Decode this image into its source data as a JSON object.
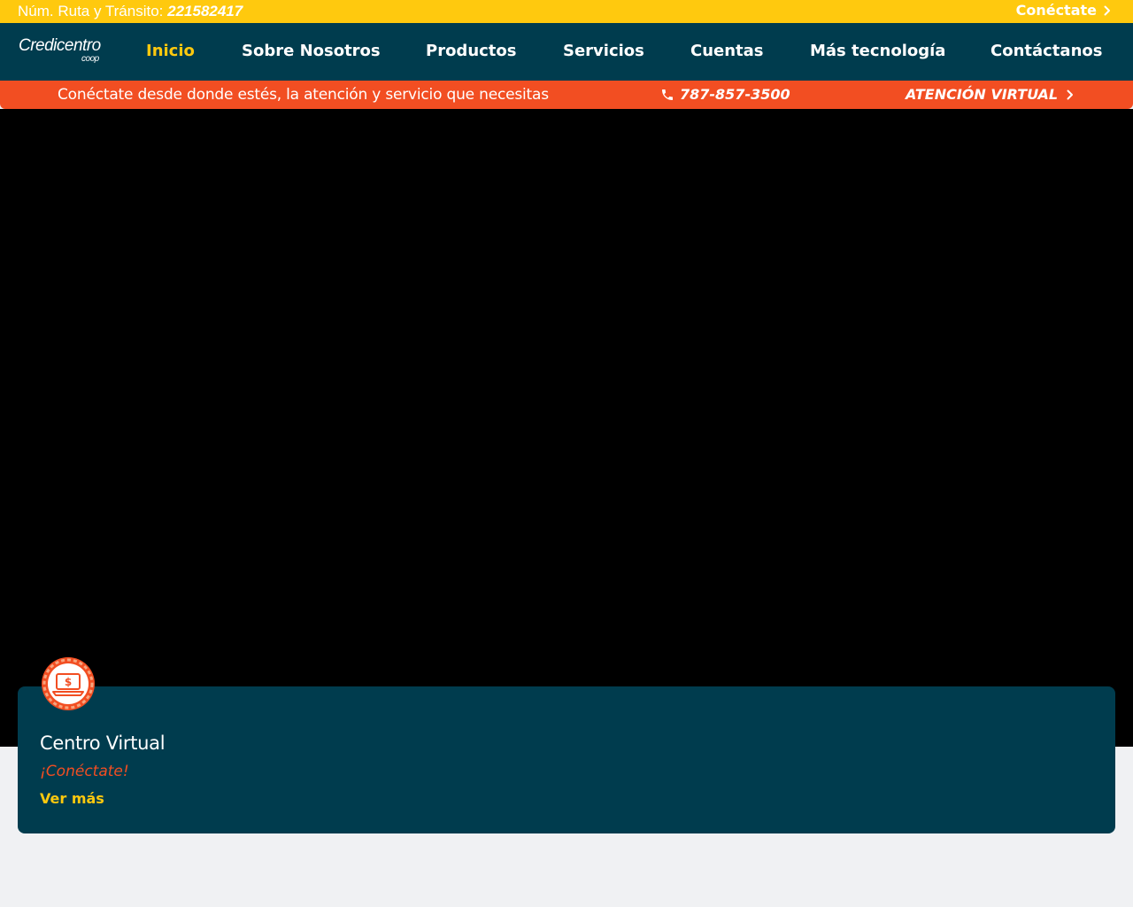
{
  "topbar": {
    "routing_label": "Núm. Ruta y Tránsito:",
    "routing_number": "221582417",
    "connect_label": "Conéctate",
    "connect_icon": "chevron-right-icon"
  },
  "logo": {
    "brand": "Credicentro",
    "sub": "coop"
  },
  "nav": {
    "items": [
      {
        "label": "Inicio",
        "active": true
      },
      {
        "label": "Sobre Nosotros"
      },
      {
        "label": "Productos"
      },
      {
        "label": "Servicios"
      },
      {
        "label": "Cuentas"
      },
      {
        "label": "Más tecnología"
      },
      {
        "label": "Contáctanos"
      }
    ]
  },
  "promo": {
    "text": "Conéctate desde donde estés, la atención y servicio que necesitas",
    "phone_icon": "phone-icon",
    "phone": "787-857-3500",
    "virtual_label": "ATENCIÓN VIRTUAL",
    "virtual_icon": "chevron-right-icon"
  },
  "card": {
    "icon": "laptop-dollar-icon",
    "title": "Centro Virtual",
    "subtitle": "¡Conéctate!",
    "link": "Ver más"
  },
  "colors": {
    "yellow": "#ffc90e",
    "navy": "#003c4e",
    "orange": "#f24e22",
    "page_bg": "#f0f1f3"
  }
}
